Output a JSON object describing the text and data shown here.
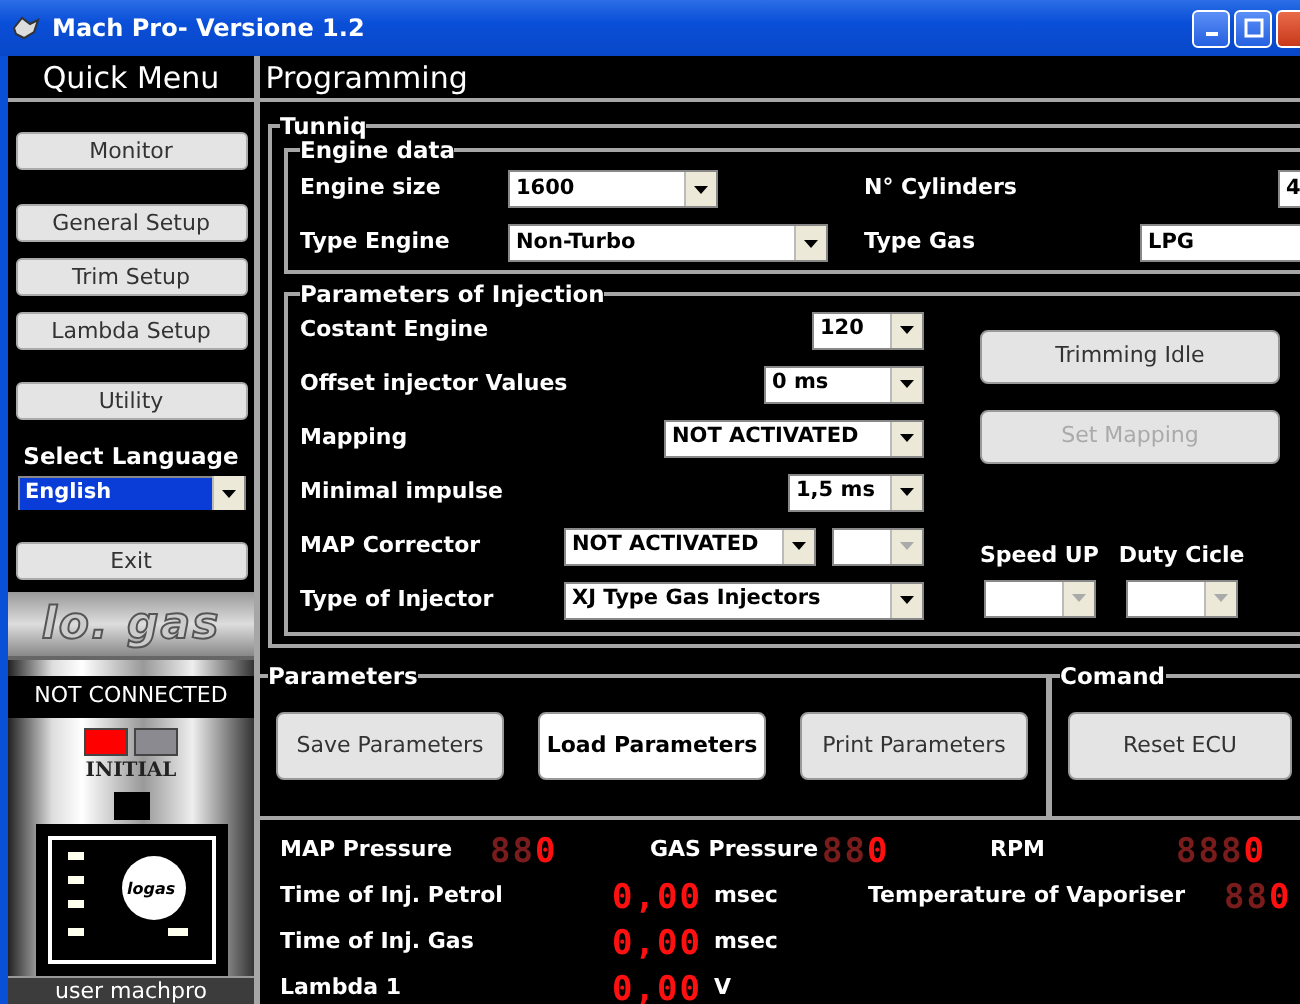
{
  "window": {
    "title": "Mach Pro- Versione 1.2"
  },
  "sidebar": {
    "title": "Quick Menu",
    "buttons": [
      {
        "label": "Monitor"
      },
      {
        "label": "General Setup"
      },
      {
        "label": "Trim Setup"
      },
      {
        "label": "Lambda Setup"
      },
      {
        "label": "Utility"
      }
    ],
    "language": {
      "label": "Select Language",
      "value": "English",
      "highlighted": true
    },
    "exit": "Exit",
    "brand": "lo. gas",
    "status": "NOT CONNECTED",
    "indicators": [
      {
        "color": "#ff0000"
      },
      {
        "color": "#8a8a90"
      }
    ],
    "mode": "INITIAL",
    "device_logo": "logas",
    "user": "user machpro"
  },
  "main": {
    "title": "Programming",
    "tuning": {
      "title": "Tunniq",
      "engine": {
        "title": "Engine data",
        "fields": [
          {
            "label": "Engine size",
            "value": "1600"
          },
          {
            "label": "N° Cylinders",
            "value": "4"
          },
          {
            "label": "Type Engine",
            "value": "Non-Turbo"
          },
          {
            "label": "Type Gas",
            "value": "LPG"
          }
        ]
      },
      "injection": {
        "title": "Parameters of Injection",
        "rows": [
          {
            "label": "Costant Engine",
            "combos": [
              {
                "value": "120",
                "disabled": false
              }
            ]
          },
          {
            "label": "Offset injector Values",
            "combos": [
              {
                "value": "0 ms",
                "disabled": false
              }
            ]
          },
          {
            "label": "Mapping",
            "combos": [
              {
                "value": "NOT ACTIVATED",
                "disabled": false
              }
            ]
          },
          {
            "label": "Minimal impulse",
            "combos": [
              {
                "value": "1,5 ms",
                "disabled": false
              }
            ]
          },
          {
            "label": "MAP Corrector",
            "combos": [
              {
                "value": "NOT ACTIVATED",
                "disabled": false
              },
              {
                "disabled": true
              }
            ]
          },
          {
            "label": "Type of Injector",
            "combos": [
              {
                "value": "XJ Type Gas Injectors",
                "disabled": false
              }
            ]
          }
        ],
        "buttons": [
          {
            "label": "Trimming Idle",
            "disabled": false
          },
          {
            "label": "Set Mapping",
            "disabled": true
          }
        ],
        "extra": [
          {
            "label": "Speed UP",
            "disabled": true
          },
          {
            "label": "Duty Cicle",
            "disabled": true
          }
        ]
      }
    },
    "parameters": {
      "title": "Parameters",
      "buttons": [
        {
          "label": "Save Parameters",
          "focused": false
        },
        {
          "label": "Load Parameters",
          "focused": true
        },
        {
          "label": "Print Parameters",
          "focused": false
        }
      ]
    },
    "command": {
      "title": "Comand",
      "buttons": [
        {
          "label": "Reset ECU",
          "focused": false
        }
      ]
    },
    "monitor": [
      {
        "items": [
          {
            "label": "MAP Pressure",
            "unlit": "88",
            "value": "0"
          },
          {
            "label": "GAS Pressure",
            "unlit": "88",
            "value": "0"
          },
          {
            "label": "RPM",
            "unlit": "888",
            "value": "0"
          }
        ]
      },
      {
        "items": [
          {
            "label": "Time of Inj. Petrol",
            "value": "0,00",
            "unit": "msec"
          },
          {
            "label": "Temperature of Vaporiser",
            "unlit": "88",
            "value": "0"
          }
        ]
      },
      {
        "items": [
          {
            "label": "Time of Inj. Gas",
            "value": "0,00",
            "unit": "msec"
          }
        ]
      },
      {
        "items": [
          {
            "label": "Lambda 1",
            "value": "0,00",
            "unit": "V"
          }
        ]
      }
    ]
  }
}
